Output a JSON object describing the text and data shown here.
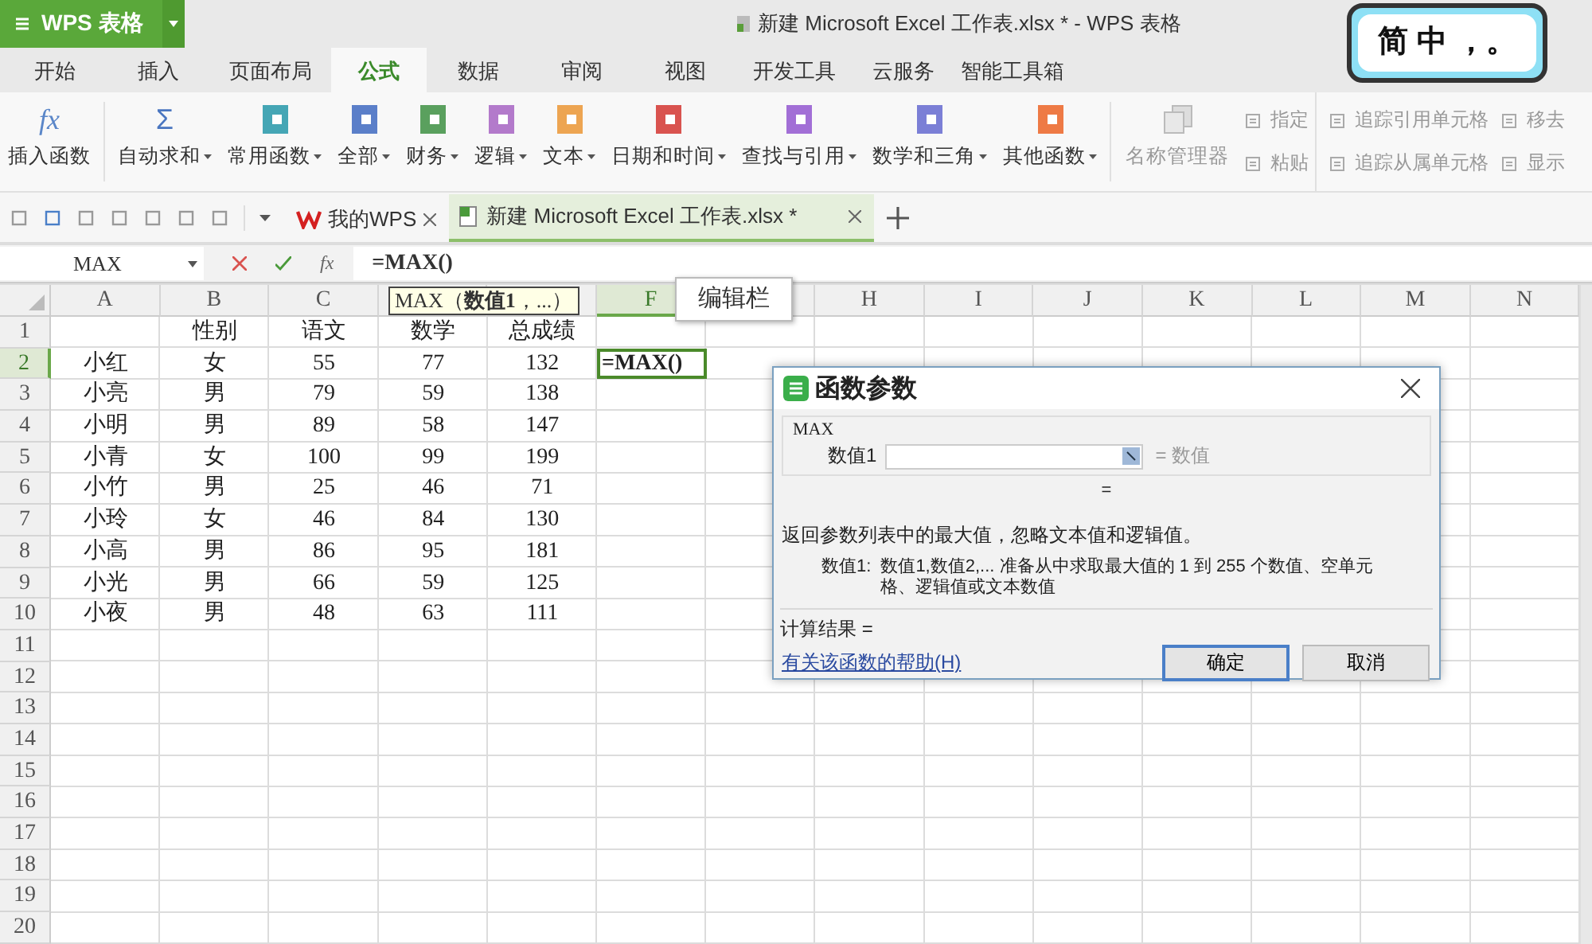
{
  "app_button": {
    "label": "WPS 表格"
  },
  "window": {
    "title": "新建 Microsoft Excel 工作表.xlsx * - WPS 表格"
  },
  "ime_indicator": {
    "text": "简 中 ，。"
  },
  "menu_tabs": [
    {
      "label": "开始",
      "selected": false
    },
    {
      "label": "插入",
      "selected": false
    },
    {
      "label": "页面布局",
      "selected": false
    },
    {
      "label": "公式",
      "selected": true
    },
    {
      "label": "数据",
      "selected": false
    },
    {
      "label": "审阅",
      "selected": false
    },
    {
      "label": "视图",
      "selected": false
    },
    {
      "label": "开发工具",
      "selected": false
    },
    {
      "label": "云服务",
      "selected": false
    },
    {
      "label": "智能工具箱",
      "selected": false
    }
  ],
  "ribbon": {
    "large": [
      {
        "kind": "glyph",
        "glyph": "fx",
        "label": "插入函数",
        "dropdown": false,
        "separator_after": true
      },
      {
        "kind": "glyph",
        "glyph": "Σ",
        "label": "自动求和",
        "dropdown": true,
        "separator_after": false
      },
      {
        "kind": "book",
        "color": "#45a6b5",
        "label": "常用函数",
        "dropdown": true,
        "separator_after": false
      },
      {
        "kind": "book",
        "color": "#5b7fc9",
        "label": "全部",
        "dropdown": true,
        "separator_after": false
      },
      {
        "kind": "book",
        "color": "#5aa05e",
        "label": "财务",
        "dropdown": true,
        "separator_after": false
      },
      {
        "kind": "book",
        "color": "#b37acb",
        "label": "逻辑",
        "dropdown": true,
        "separator_after": false
      },
      {
        "kind": "book",
        "color": "#eda552",
        "label": "文本",
        "dropdown": true,
        "separator_after": false
      },
      {
        "kind": "book",
        "color": "#d9534f",
        "label": "日期和时间",
        "dropdown": true,
        "separator_after": false
      },
      {
        "kind": "book",
        "color": "#a26fd6",
        "label": "查找与引用",
        "dropdown": true,
        "separator_after": false
      },
      {
        "kind": "book",
        "color": "#7b7fd6",
        "label": "数学和三角",
        "dropdown": true,
        "separator_after": false
      },
      {
        "kind": "book",
        "color": "#ee7a45",
        "label": "其他函数",
        "dropdown": true,
        "separator_after": true
      },
      {
        "kind": "disabled",
        "label": "名称管理器",
        "dropdown": false,
        "separator_after": false
      }
    ],
    "small_columns": [
      [
        {
          "label": "指定"
        },
        {
          "label": "粘贴"
        }
      ],
      [
        {
          "label": "追踪引用单元格"
        },
        {
          "label": "追踪从属单元格"
        }
      ],
      [
        {
          "label": "移去"
        },
        {
          "label": "显示"
        }
      ]
    ]
  },
  "doc_tabs": [
    {
      "kind": "home",
      "label": "我的WPS",
      "selected": false
    },
    {
      "kind": "sheet",
      "label": "新建 Microsoft Excel 工作表.xlsx *",
      "selected": true
    }
  ],
  "formula_bar": {
    "name_box": "MAX",
    "fx": "fx",
    "value": "=MAX()"
  },
  "function_hint": "MAX（**数值1**，...）",
  "tooltip": "编辑栏",
  "columns": [
    {
      "label": "A",
      "selected": false
    },
    {
      "label": "B",
      "selected": false
    },
    {
      "label": "C",
      "selected": false
    },
    {
      "selected": false
    },
    {
      "selected": false
    },
    {
      "label": "F",
      "selected": true
    },
    {
      "selected": false
    },
    {
      "label": "H",
      "selected": false
    },
    {
      "label": "I",
      "selected": false
    },
    {
      "label": "J",
      "selected": false
    },
    {
      "label": "K",
      "selected": false
    },
    {
      "label": "L",
      "selected": false
    },
    {
      "label": "M",
      "selected": false
    },
    {
      "label": "N",
      "selected": false
    }
  ],
  "rows": [
    {
      "label": "1",
      "selected": false,
      "kind": "header",
      "cells": [
        "性别",
        "语文",
        "数学",
        "总成绩"
      ]
    },
    {
      "label": "2",
      "selected": true,
      "kind": "data",
      "cells": [
        "小红",
        "女",
        "55",
        "77",
        "132",
        "=MAX()"
      ]
    },
    {
      "label": "3",
      "selected": false,
      "kind": "data",
      "cells": [
        "小亮",
        "男",
        "79",
        "59",
        "138"
      ]
    },
    {
      "label": "4",
      "selected": false,
      "kind": "data",
      "cells": [
        "小明",
        "男",
        "89",
        "58",
        "147"
      ]
    },
    {
      "label": "5",
      "selected": false,
      "kind": "data",
      "cells": [
        "小青",
        "女",
        "100",
        "99",
        "199"
      ]
    },
    {
      "label": "6",
      "selected": false,
      "kind": "data",
      "cells": [
        "小竹",
        "男",
        "25",
        "46",
        "71"
      ]
    },
    {
      "label": "7",
      "selected": false,
      "kind": "data",
      "cells": [
        "小玲",
        "女",
        "46",
        "84",
        "130"
      ]
    },
    {
      "label": "8",
      "selected": false,
      "kind": "data",
      "cells": [
        "小高",
        "男",
        "86",
        "95",
        "181"
      ]
    },
    {
      "label": "9",
      "selected": false,
      "kind": "data",
      "cells": [
        "小光",
        "男",
        "66",
        "59",
        "125"
      ]
    },
    {
      "label": "10",
      "selected": false,
      "kind": "data",
      "cells": [
        "小夜",
        "男",
        "48",
        "63",
        "111"
      ]
    },
    {
      "label": "11",
      "selected": false
    },
    {
      "label": "12",
      "selected": false
    },
    {
      "label": "13",
      "selected": false
    },
    {
      "label": "14",
      "selected": false
    },
    {
      "label": "15",
      "selected": false
    },
    {
      "label": "16",
      "selected": false
    },
    {
      "label": "17",
      "selected": false
    },
    {
      "label": "18",
      "selected": false
    },
    {
      "label": "19",
      "selected": false
    },
    {
      "label": "20",
      "selected": false
    }
  ],
  "dialog": {
    "title": "函数参数",
    "function": "MAX",
    "arg_label": "数值1",
    "arg_result": "= 数值",
    "result_eq": "=",
    "description": "返回参数列表中的最大值，忽略文本值和逻辑值。",
    "arg_help_label": "数值1:",
    "arg_help": "数值1,数值2,... 准备从中求取最大值的 1 到 255 个数值、空单元格、逻辑值或文本数值",
    "calc_result": "计算结果 =",
    "help_link": "有关该函数的帮助(H)",
    "buttons": [
      {
        "label": "确定",
        "default": true
      },
      {
        "label": "取消",
        "default": false
      }
    ]
  }
}
